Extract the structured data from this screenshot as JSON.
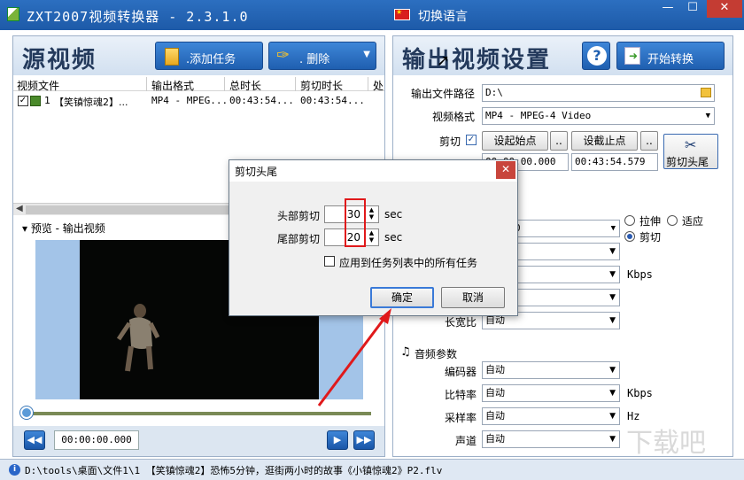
{
  "window": {
    "title": "ZXT2007视频转换器 - 2.3.1.0",
    "language_button": "切换语言",
    "minimize": "—",
    "maximize": "☐",
    "close": "✕"
  },
  "left": {
    "title": "源视频",
    "add_task": ".添加任务",
    "delete": ".     删除",
    "columns": [
      "视频文件",
      "输出格式",
      "总时长",
      "剪切时长",
      "处"
    ],
    "tasks": [
      {
        "index": "1",
        "name": "【笑镇惊魂2】...",
        "format": "MP4 - MPEG...",
        "duration": "00:43:54...",
        "cut": "00:43:54..."
      }
    ],
    "preview_label": "预览 - 输出视频",
    "timecode": "00:00:00.000"
  },
  "right": {
    "title": "输出视频设置",
    "start": "开始转换",
    "output_path_label": "输出文件路径",
    "output_path": "D:\\",
    "video_format_label": "视频格式",
    "video_format": "MP4 - MPEG-4 Video",
    "cut_label": "剪切",
    "set_start": "设起始点",
    "set_end": "设截止点",
    "dots": "..",
    "start_time": "00:00:00.000",
    "end_time": "00:43:54.579",
    "cut_head_tail": "剪切头尾",
    "stretch": "拉伸",
    "fit": "适应",
    "crop": "剪切",
    "video_size_value": "0",
    "kbps": "Kbps",
    "aspect_label": "长宽比",
    "aspect": "自动",
    "audio_section": "音频参数",
    "encoder_label": "编码器",
    "encoder": "自动",
    "bitrate_label": "比特率",
    "bitrate": "自动",
    "samplerate_label": "采样率",
    "samplerate": "自动",
    "hz": "Hz",
    "channels_label": "声道",
    "channels": "自动"
  },
  "dialog": {
    "title": "剪切头尾",
    "close": "✕",
    "head_label": "头部剪切",
    "head_value": "30",
    "tail_label": "尾部剪切",
    "tail_value": "20",
    "unit": "sec",
    "apply_all": "应用到任务列表中的所有任务",
    "ok": "确定",
    "cancel": "取消"
  },
  "status": {
    "info_icon": "i",
    "text": "D:\\tools\\桌面\\文件1\\1 【笑镇惊魂2】恐怖5分钟，逛街两小时的故事《小镇惊魂2》P2.flv"
  }
}
